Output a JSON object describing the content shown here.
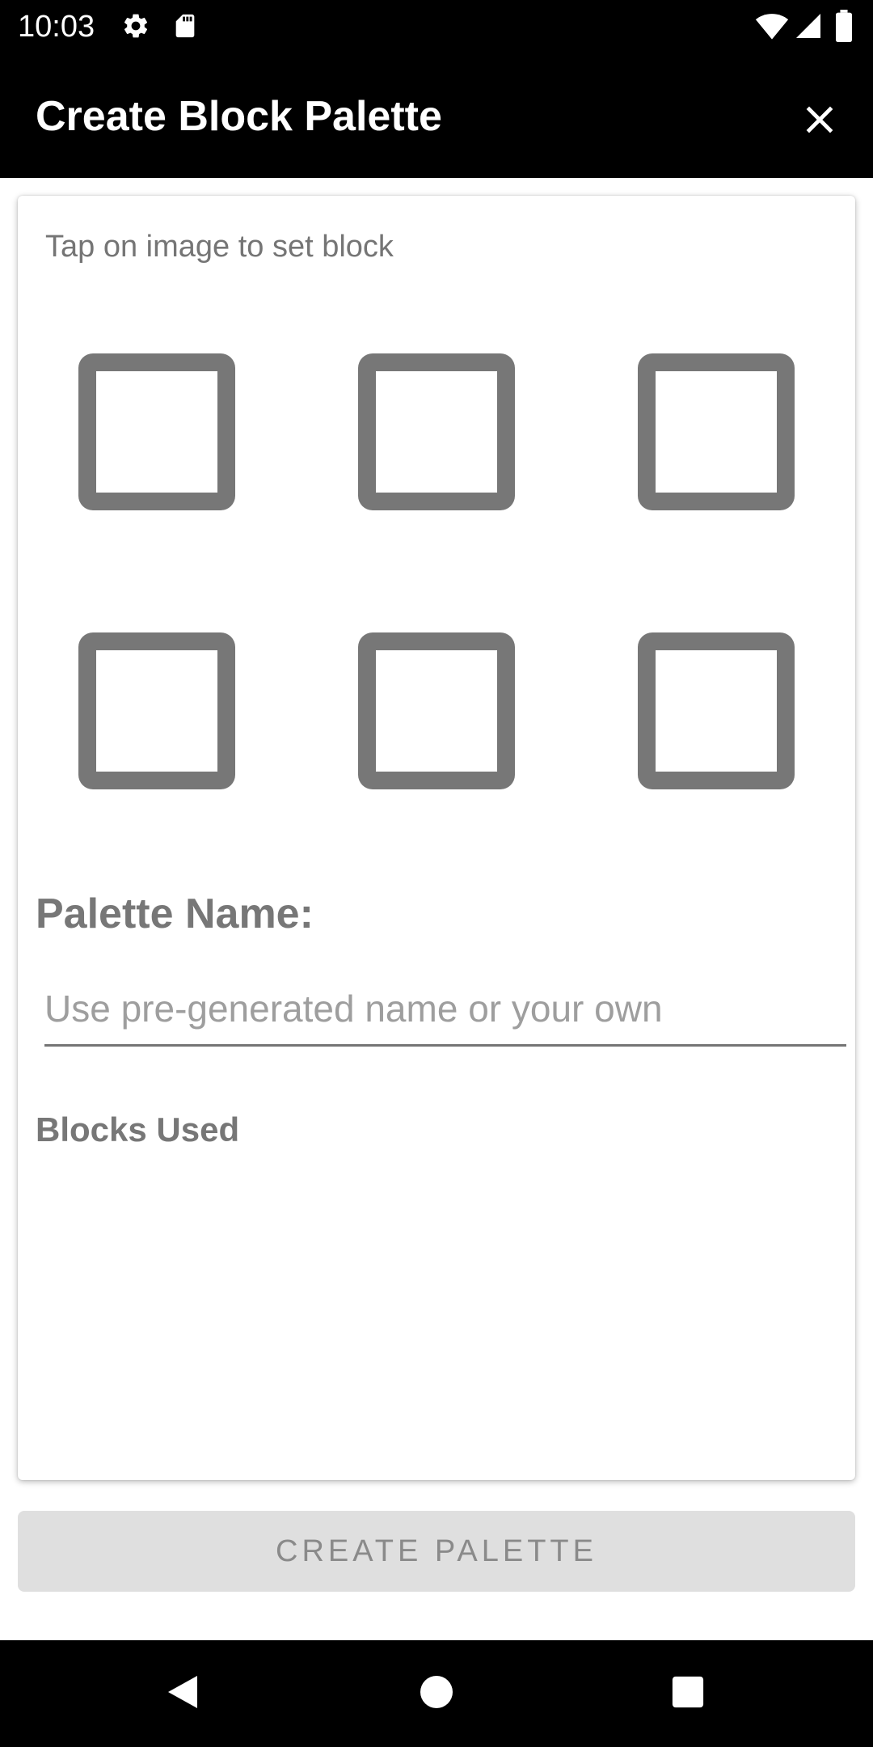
{
  "status_bar": {
    "time": "10:03",
    "icons": [
      "gear-icon",
      "sd-card-icon",
      "wifi-icon",
      "signal-icon",
      "battery-icon"
    ]
  },
  "toolbar": {
    "title": "Create Block Palette",
    "close_icon": "close-icon"
  },
  "card": {
    "hint": "Tap on image to set block",
    "block_slots": 6,
    "palette_name_label": "Palette Name:",
    "name_input": {
      "value": "",
      "placeholder": "Use pre-generated name or your own"
    },
    "blocks_used_label": "Blocks Used"
  },
  "create_button": {
    "label": "CREATE PALETTE",
    "enabled": false
  },
  "nav_bar": {
    "icons": [
      "back-icon",
      "home-icon",
      "recents-icon"
    ]
  },
  "colors": {
    "bar_background": "#000000",
    "slot_border": "#777777",
    "button_disabled_bg": "#dfdfdf",
    "button_disabled_text": "#8a8a8a"
  }
}
